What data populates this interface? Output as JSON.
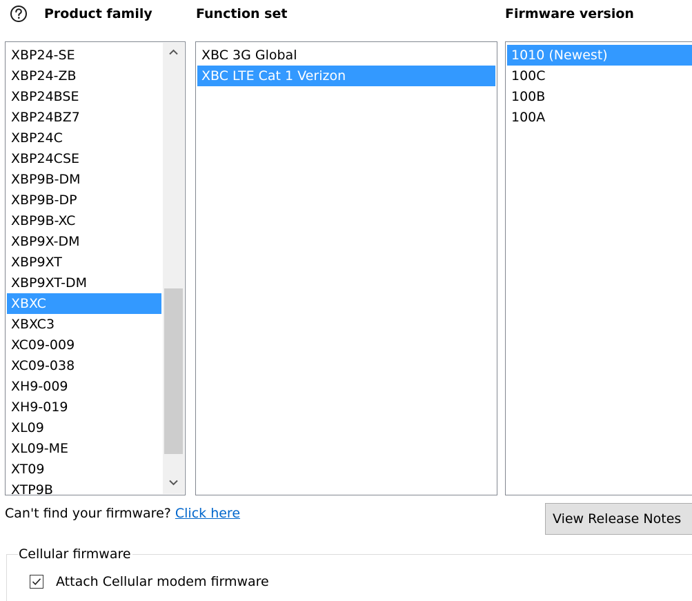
{
  "headers": {
    "help_icon": "question-circle-icon",
    "product_family": "Product family",
    "function_set": "Function set",
    "firmware_version": "Firmware version"
  },
  "product_family": {
    "items": [
      "XBP24-SE",
      "XBP24-ZB",
      "XBP24BSE",
      "XBP24BZ7",
      "XBP24C",
      "XBP24CSE",
      "XBP9B-DM",
      "XBP9B-DP",
      "XBP9B-XC",
      "XBP9X-DM",
      "XBP9XT",
      "XBP9XT-DM",
      "XBXC",
      "XBXC3",
      "XC09-009",
      "XC09-038",
      "XH9-009",
      "XH9-019",
      "XL09",
      "XL09-ME",
      "XT09",
      "XTP9B"
    ],
    "selected": "XBXC"
  },
  "function_set": {
    "items": [
      "XBC 3G Global",
      "XBC LTE Cat 1 Verizon"
    ],
    "selected": "XBC LTE Cat 1 Verizon"
  },
  "firmware_version": {
    "items": [
      "1010 (Newest)",
      "100C",
      "100B",
      "100A"
    ],
    "selected": "1010 (Newest)"
  },
  "footer": {
    "cant_find_text": "Can't find your firmware?",
    "click_here": "Click here",
    "release_notes_button": "View Release Notes"
  },
  "cellular": {
    "group_title": "Cellular firmware",
    "checkbox_label": "Attach Cellular modem firmware",
    "checked": true
  },
  "colors": {
    "selection": "#3399ff",
    "link": "#0066cc"
  }
}
